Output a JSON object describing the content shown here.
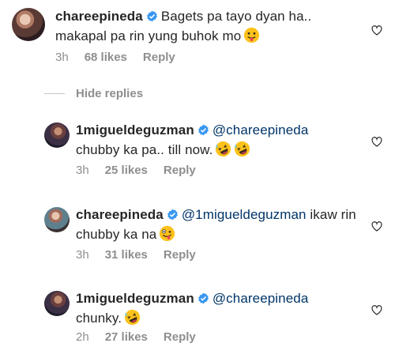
{
  "comments": [
    {
      "username": "chareepineda",
      "text": "Bagets pa tayo dyan ha.. makapal pa rin yung buhok mo",
      "time": "3h",
      "likes": "68 likes",
      "reply": "Reply"
    }
  ],
  "hide_replies": "Hide replies",
  "replies": [
    {
      "username": "1migueldeguzman",
      "mention": "@chareepineda",
      "text": "chubby ka pa.. till now.",
      "time": "3h",
      "likes": "25 likes",
      "reply": "Reply"
    },
    {
      "username": "chareepineda",
      "mention": "@1migueldeguzman",
      "text": "ikaw rin chubby ka na",
      "time": "3h",
      "likes": "31 likes",
      "reply": "Reply"
    },
    {
      "username": "1migueldeguzman",
      "mention": "@chareepineda",
      "text": "chunky.",
      "time": "2h",
      "likes": "27 likes",
      "reply": "Reply"
    }
  ],
  "colors": {
    "verified": "#3897f0",
    "mention": "#003569",
    "meta": "#8e8e8e",
    "emoji": "#fcc21b"
  },
  "icons": {
    "verified": "verified-badge-icon",
    "like": "heart-outline-icon",
    "emoji_tongue": "face-tongue-emoji",
    "emoji_rofl": "rolling-laughing-emoji",
    "emoji_zany": "zany-face-emoji"
  }
}
